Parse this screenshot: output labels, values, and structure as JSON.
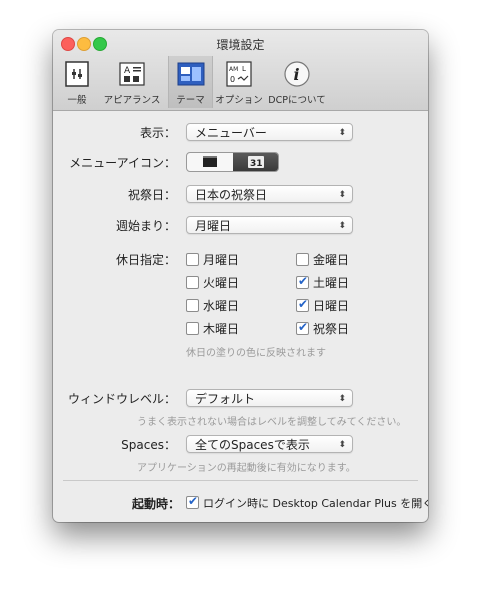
{
  "window": {
    "title": "環境設定"
  },
  "toolbar": {
    "items": [
      {
        "label": "一般"
      },
      {
        "label": "アピアランス"
      },
      {
        "label": "テーマ"
      },
      {
        "label": "オプション"
      },
      {
        "label": "DCPについて"
      }
    ],
    "selected": "テーマ"
  },
  "form": {
    "display": {
      "label": "表示：",
      "value": "メニューバー"
    },
    "menu_icon": {
      "label": "メニューアイコン：",
      "right_icon_text": "31"
    },
    "holiday": {
      "label": "祝祭日：",
      "value": "日本の祝祭日"
    },
    "week_start": {
      "label": "週始まり：",
      "value": "月曜日"
    },
    "days_off": {
      "label": "休日指定：",
      "days": [
        {
          "label": "月曜日",
          "checked": false
        },
        {
          "label": "金曜日",
          "checked": false
        },
        {
          "label": "火曜日",
          "checked": false
        },
        {
          "label": "土曜日",
          "checked": true
        },
        {
          "label": "水曜日",
          "checked": false
        },
        {
          "label": "日曜日",
          "checked": true
        },
        {
          "label": "木曜日",
          "checked": false
        },
        {
          "label": "祝祭日",
          "checked": true
        }
      ],
      "hint": "休日の塗りの色に反映されます"
    },
    "window_level": {
      "label": "ウィンドウレベル：",
      "value": "デフォルト",
      "hint": "うまく表示されない場合はレベルを調整してみてください。"
    },
    "spaces": {
      "label": "Spaces：",
      "value": "全てのSpacesで表示",
      "hint": "アプリケーションの再起動後に有効になります。"
    },
    "startup": {
      "label": "起動時：",
      "checkbox_label": "ログイン時に Desktop Calendar Plus を開く",
      "checked": true
    }
  },
  "colors": {
    "accent": "#2463c7",
    "close": "#fc605c",
    "minimize": "#fdbc40",
    "zoom": "#34c84a"
  }
}
